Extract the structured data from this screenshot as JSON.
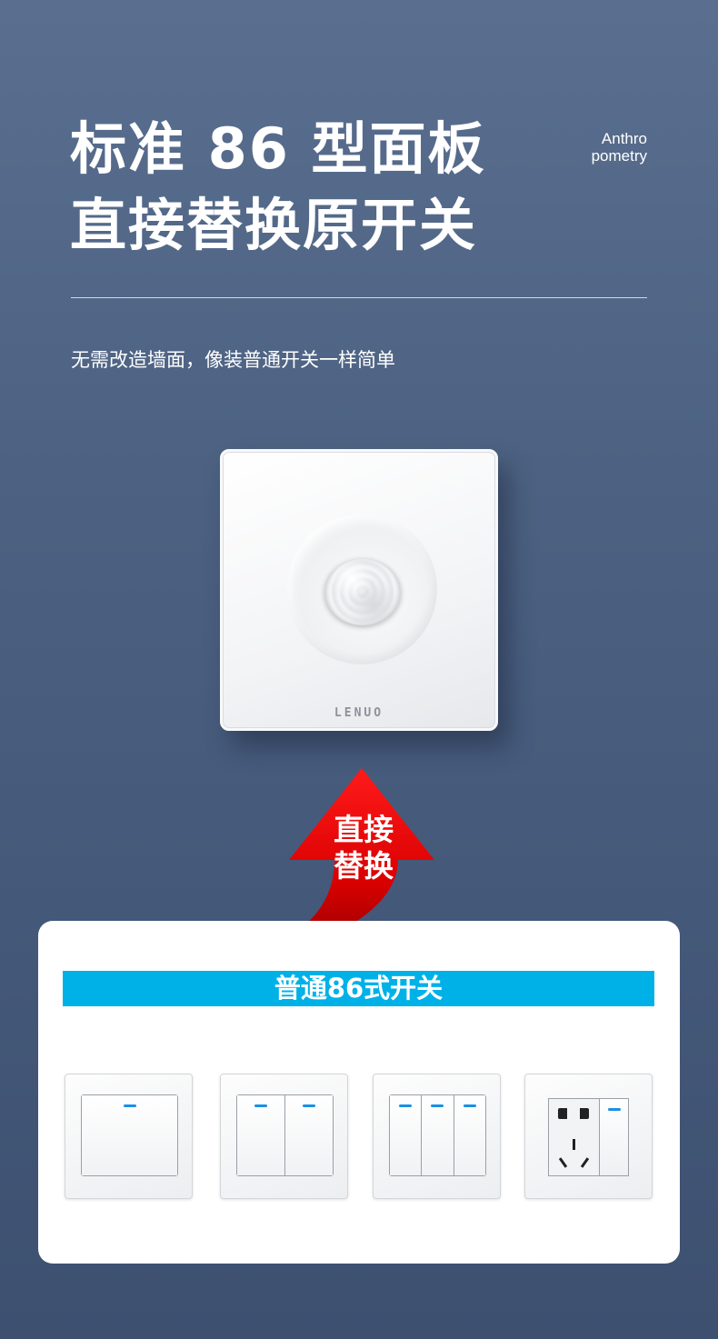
{
  "headline": {
    "line1": "标准 86 型面板",
    "line2": "直接替换原开关"
  },
  "side_label": {
    "line1": "Anthro",
    "line2": "pometry"
  },
  "subtitle": "无需改造墙面，像装普通开关一样简单",
  "sensor_panel": {
    "brand": "LENUO"
  },
  "arrow": {
    "label_line1": "直接",
    "label_line2": "替换",
    "color": "#d90000"
  },
  "card": {
    "banner": "普通86式开关",
    "banner_color": "#00b1e8",
    "switches": [
      {
        "type": "1-gang switch"
      },
      {
        "type": "2-gang switch"
      },
      {
        "type": "3-gang switch"
      },
      {
        "type": "5-hole socket with switch"
      }
    ]
  }
}
